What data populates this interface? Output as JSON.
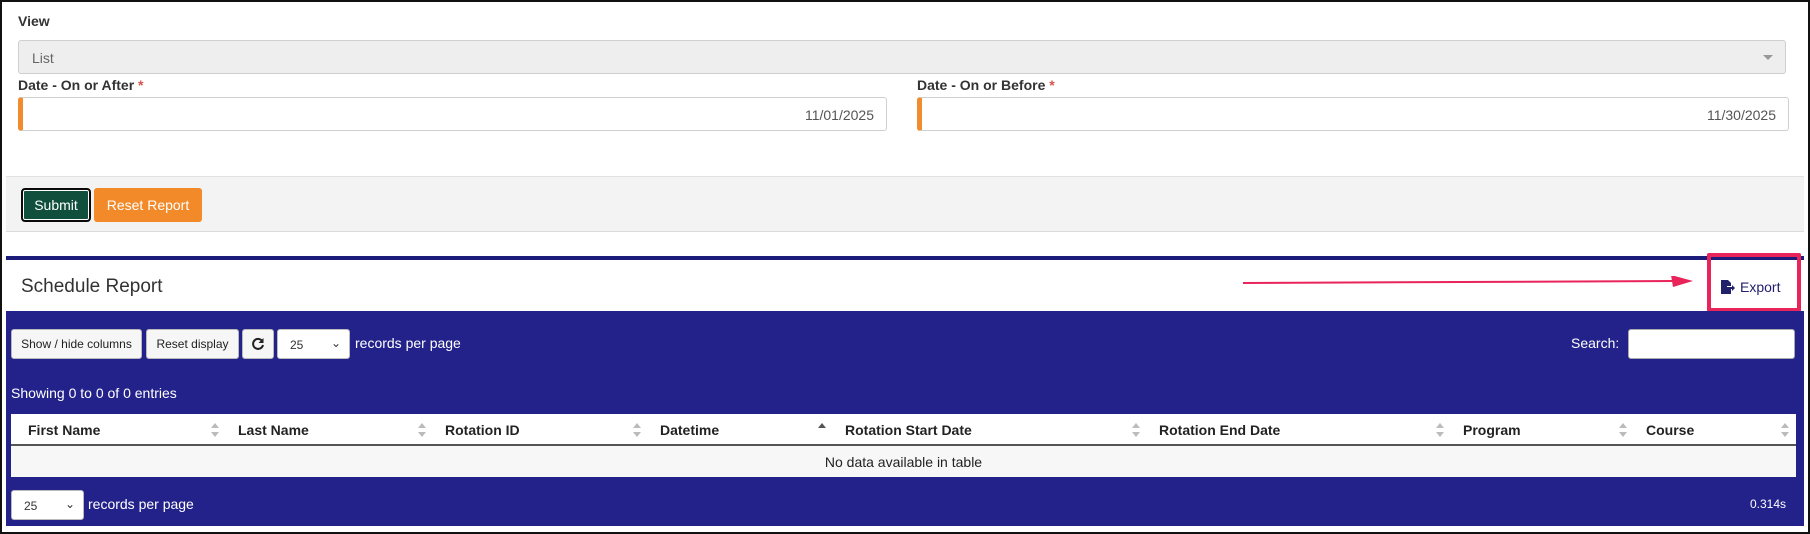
{
  "filters": {
    "view_label": "View",
    "view_value": "List",
    "date_after_label": "Date - On or After",
    "date_after_value": "11/01/2025",
    "date_before_label": "Date - On or Before",
    "date_before_value": "11/30/2025",
    "required_marker": "*"
  },
  "actions": {
    "submit_label": "Submit",
    "reset_label": "Reset Report"
  },
  "report": {
    "title": "Schedule Report",
    "export_label": "Export"
  },
  "datatable": {
    "show_hide_label": "Show / hide columns",
    "reset_display_label": "Reset display",
    "page_size": "25",
    "records_per_page_label": "records per page",
    "search_label": "Search:",
    "search_value": "",
    "info_text": "Showing 0 to 0 of 0 entries",
    "columns": [
      "First Name",
      "Last Name",
      "Rotation ID",
      "Datetime",
      "Rotation Start Date",
      "Rotation End Date",
      "Program",
      "Course"
    ],
    "empty_message": "No data available in table",
    "timing": "0.314s"
  },
  "colors": {
    "table_bg": "#22228a",
    "accent_orange": "#f28a2a",
    "submit_green": "#0f4f3c",
    "highlight": "#e8245b"
  }
}
